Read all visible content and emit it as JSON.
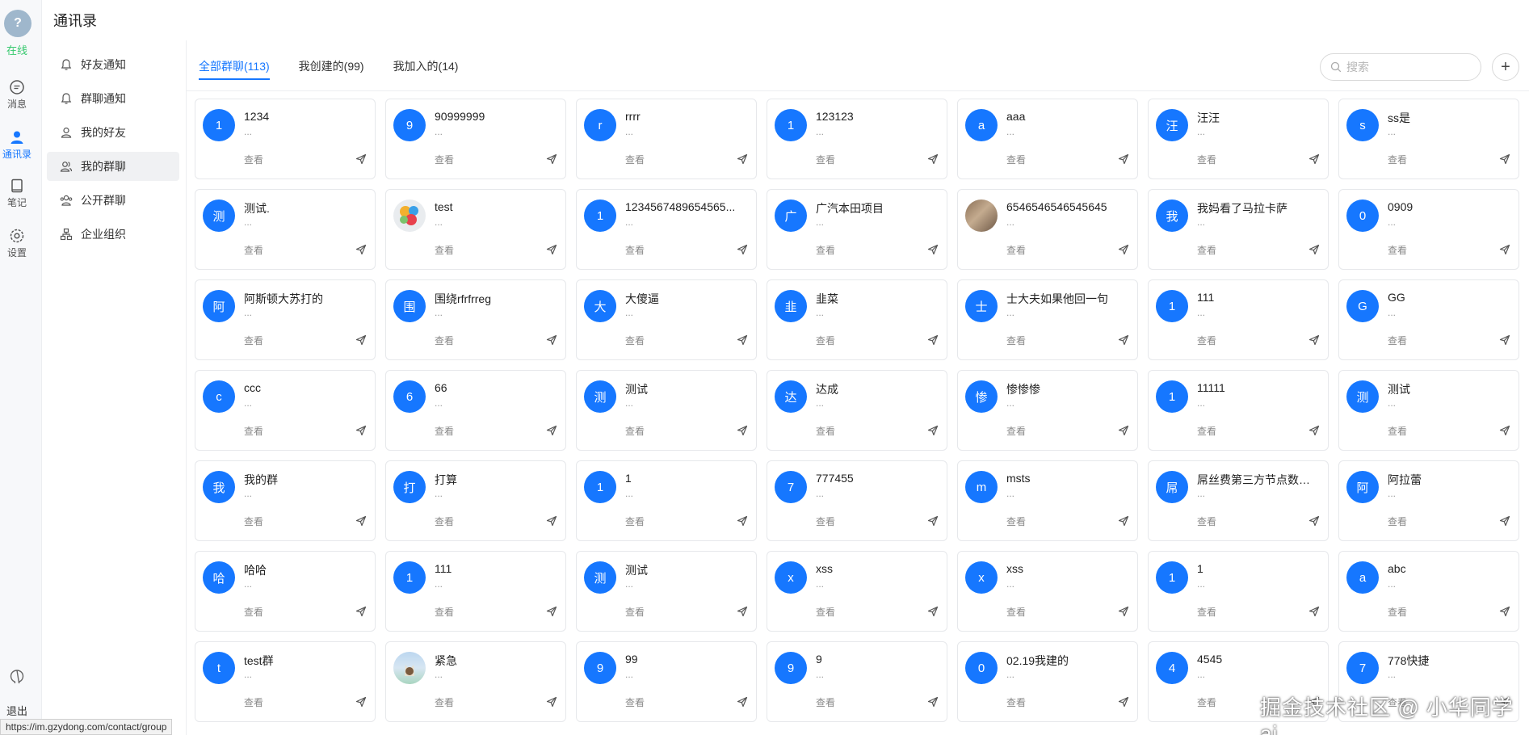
{
  "app": {
    "title": "通讯录",
    "status_text": "在线",
    "status_url": "https://im.gzydong.com/contact/group",
    "watermark": "掘金技术社区 @ 小华同学ai"
  },
  "rail": {
    "items": [
      {
        "label": "消息",
        "icon": "message-icon"
      },
      {
        "label": "通讯录",
        "icon": "contacts-icon",
        "active": true
      },
      {
        "label": "笔记",
        "icon": "notes-icon"
      },
      {
        "label": "设置",
        "icon": "settings-icon"
      }
    ],
    "logout_label": "退出"
  },
  "subnav": {
    "items": [
      {
        "label": "好友通知",
        "icon": "bell-icon"
      },
      {
        "label": "群聊通知",
        "icon": "bell-icon"
      },
      {
        "label": "我的好友",
        "icon": "user-icon"
      },
      {
        "label": "我的群聊",
        "icon": "group-icon",
        "active": true
      },
      {
        "label": "公开群聊",
        "icon": "group-icon"
      },
      {
        "label": "企业组织",
        "icon": "org-icon"
      }
    ]
  },
  "tabs": [
    {
      "label": "全部群聊(113)",
      "active": true
    },
    {
      "label": "我创建的(99)"
    },
    {
      "label": "我加入的(14)"
    }
  ],
  "search": {
    "placeholder": "搜索",
    "value": ""
  },
  "add_label": "+",
  "card_common": {
    "sub": "...",
    "view_label": "查看"
  },
  "groups": [
    {
      "name": "1234",
      "avatar": "1"
    },
    {
      "name": "90999999",
      "avatar": "9"
    },
    {
      "name": "rrrr",
      "avatar": "r"
    },
    {
      "name": "123123",
      "avatar": "1"
    },
    {
      "name": "aaa",
      "avatar": "a"
    },
    {
      "name": "汪汪",
      "avatar": "汪"
    },
    {
      "name": "ss是",
      "avatar": "s"
    },
    {
      "name": "测试.",
      "avatar": "测"
    },
    {
      "name": "test",
      "avatar": "",
      "image": "colorful"
    },
    {
      "name": "1234567489654565...",
      "avatar": "1"
    },
    {
      "name": "广汽本田项目",
      "avatar": "广"
    },
    {
      "name": "6546546546545645",
      "avatar": "",
      "image": "wood"
    },
    {
      "name": "我妈看了马拉卡萨",
      "avatar": "我"
    },
    {
      "name": "0909",
      "avatar": "0"
    },
    {
      "name": "阿斯顿大苏打的",
      "avatar": "阿"
    },
    {
      "name": "围绕rfrfrreg",
      "avatar": "围"
    },
    {
      "name": "大傻逼",
      "avatar": "大"
    },
    {
      "name": "韭菜",
      "avatar": "韭"
    },
    {
      "name": "士大夫如果他回一句",
      "avatar": "士"
    },
    {
      "name": "111",
      "avatar": "1"
    },
    {
      "name": "GG",
      "avatar": "G"
    },
    {
      "name": "ccc",
      "avatar": "c"
    },
    {
      "name": "66",
      "avatar": "6"
    },
    {
      "name": "测试",
      "avatar": "测"
    },
    {
      "name": "达成",
      "avatar": "达"
    },
    {
      "name": "惨惨惨",
      "avatar": "惨"
    },
    {
      "name": "11111",
      "avatar": "1"
    },
    {
      "name": "测试",
      "avatar": "测"
    },
    {
      "name": "我的群",
      "avatar": "我"
    },
    {
      "name": "打算",
      "avatar": "打"
    },
    {
      "name": "1",
      "avatar": "1"
    },
    {
      "name": "777455",
      "avatar": "7"
    },
    {
      "name": "msts",
      "avatar": "m"
    },
    {
      "name": "屌丝费第三方节点数据...",
      "avatar": "屌"
    },
    {
      "name": "阿拉蕾",
      "avatar": "阿"
    },
    {
      "name": "哈哈",
      "avatar": "哈"
    },
    {
      "name": "111",
      "avatar": "1"
    },
    {
      "name": "测试",
      "avatar": "测"
    },
    {
      "name": "xss",
      "avatar": "x"
    },
    {
      "name": "xss",
      "avatar": "x"
    },
    {
      "name": "1",
      "avatar": "1"
    },
    {
      "name": "abc",
      "avatar": "a"
    },
    {
      "name": "test群",
      "avatar": "t"
    },
    {
      "name": "紧急",
      "avatar": "",
      "image": "cat"
    },
    {
      "name": "99",
      "avatar": "9"
    },
    {
      "name": "9",
      "avatar": "9"
    },
    {
      "name": "02.19我建的",
      "avatar": "0"
    },
    {
      "name": "4545",
      "avatar": "4"
    },
    {
      "name": "778快捷",
      "avatar": "7"
    }
  ],
  "colors": {
    "accent": "#1677ff",
    "online": "#35c86d"
  }
}
